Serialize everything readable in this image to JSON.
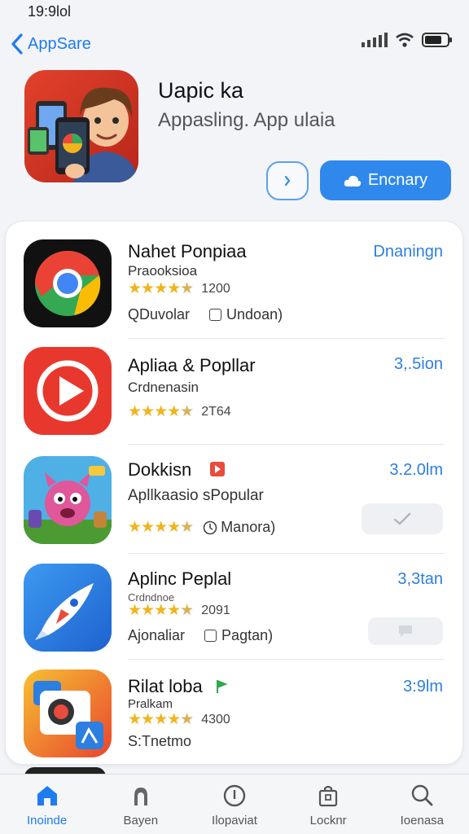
{
  "status": {
    "time": "19:9lol"
  },
  "nav": {
    "back_label": "AppSare"
  },
  "featured": {
    "title": "Uapic ka",
    "subtitle": "Appasling. App ulaia",
    "get_label": "Encnary"
  },
  "apps": [
    {
      "name": "Nahet Ponpiaa",
      "subtitle": "Praooksioa",
      "rating": 4.5,
      "rating_count": "1200",
      "meta_left": "QDuvolar",
      "meta_right": "Undoan)",
      "action": "Dnaningn",
      "icon": "chrome-like-icon",
      "accent": "#e8453c"
    },
    {
      "name": "Apliaa & Popllar",
      "subtitle": "Crdnenasin",
      "rating": 4.5,
      "rating_count": "2T64",
      "action": "3,.5ion",
      "icon": "play-icon",
      "accent": "#e8382e"
    },
    {
      "name": "Dokkisn",
      "subtitle": "Apllkaasio sPopular",
      "rating": 4.5,
      "rating_count": "",
      "meta_right": "Manora)",
      "action": "3.2.0lm",
      "icon": "game-monster-icon",
      "accent": "#e94b3c"
    },
    {
      "name": "Aplinc Peplal",
      "subtitle": "Crdndnoe",
      "rating": 4.5,
      "rating_count": "2091",
      "meta_left": "Ajonaliar",
      "meta_right": "Pagtan)",
      "action": "3,3tan",
      "icon": "rocket-icon",
      "accent": "#2f7fe8"
    },
    {
      "name": "Rilat loba",
      "subtitle": "Pralkam",
      "rating": 4.5,
      "rating_count": "4300",
      "meta_left": "S:Tnetmo",
      "action": "3:9lm",
      "icon": "photo-editor-icon",
      "accent": "#f0a020"
    }
  ],
  "tabs": [
    {
      "label": "Inoinde",
      "icon": "home-icon",
      "active": true
    },
    {
      "label": "Bayen",
      "icon": "arcade-icon",
      "active": false
    },
    {
      "label": "Ilopaviat",
      "icon": "info-icon",
      "active": false
    },
    {
      "label": "Locknr",
      "icon": "bag-icon",
      "active": false
    },
    {
      "label": "Ioenasa",
      "icon": "search-icon",
      "active": false
    }
  ],
  "colors": {
    "accent": "#1d7cf2",
    "star": "#f0b41c",
    "get_button": "#2f88ec"
  }
}
